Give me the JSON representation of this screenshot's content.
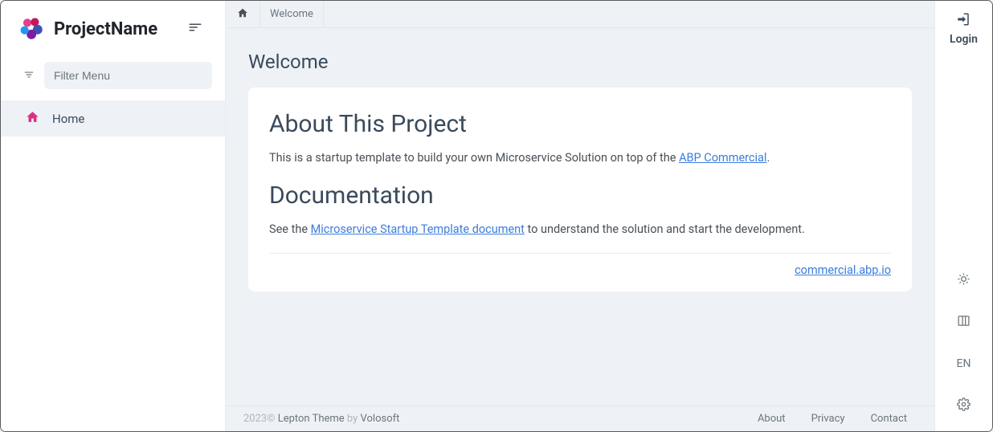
{
  "brand": {
    "name": "ProjectName"
  },
  "sidebar": {
    "filter_placeholder": "Filter Menu",
    "items": [
      {
        "label": "Home"
      }
    ]
  },
  "breadcrumb": {
    "current": "Welcome"
  },
  "page": {
    "title": "Welcome",
    "sections": {
      "about": {
        "heading": "About This Project",
        "text_before": "This is a startup template to build your own Microservice Solution on top of the ",
        "link": "ABP Commercial",
        "text_after": "."
      },
      "docs": {
        "heading": "Documentation",
        "text_before": "See the ",
        "link": "Microservice Startup Template document",
        "text_after": " to understand the solution and start the development."
      },
      "footer_link": "commercial.abp.io"
    }
  },
  "rightbar": {
    "login": "Login",
    "language": "EN"
  },
  "footer": {
    "year": "2023",
    "copy": "© ",
    "theme": "Lepton Theme",
    "by": " by ",
    "company": "Volosoft",
    "links": [
      {
        "label": "About"
      },
      {
        "label": "Privacy"
      },
      {
        "label": "Contact"
      }
    ]
  }
}
